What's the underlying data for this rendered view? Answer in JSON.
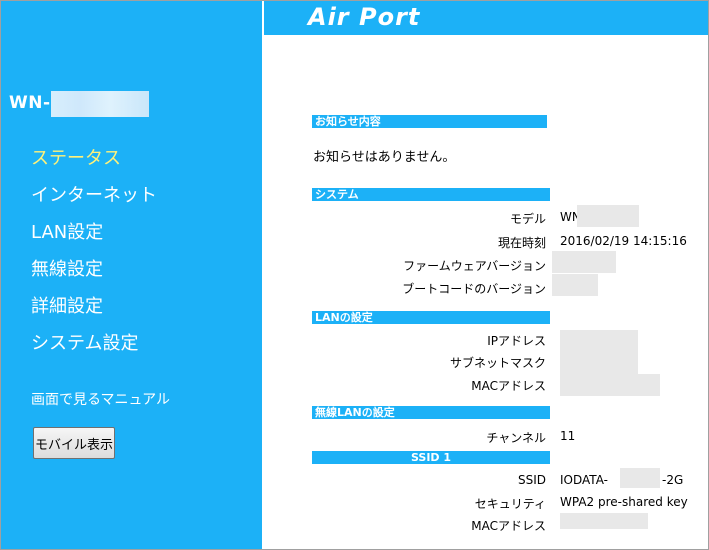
{
  "header": {
    "logo": "Air Port"
  },
  "sidebar": {
    "model_prefix": "WN-",
    "nav_items": [
      {
        "label": "ステータス",
        "active": true
      },
      {
        "label": "インターネット"
      },
      {
        "label": "LAN設定"
      },
      {
        "label": "無線設定"
      },
      {
        "label": "詳細設定"
      },
      {
        "label": "システム設定"
      }
    ],
    "manual_link": "画面で見るマニュアル",
    "mobile_button": "モバイル表示"
  },
  "notice": {
    "title": "お知らせ内容",
    "text": "お知らせはありません。"
  },
  "system": {
    "title": "システム",
    "model_label": "モデル",
    "model_value": "WN",
    "time_label": "現在時刻",
    "time_value": "2016/02/19 14:15:16",
    "firmware_label": "ファームウェアバージョン",
    "boot_label": "ブートコードのバージョン"
  },
  "lan": {
    "title": "LANの設定",
    "ip_label": "IPアドレス",
    "subnet_label": "サブネットマスク",
    "mac_label": "MACアドレス"
  },
  "wireless": {
    "title": "無線LANの設定",
    "channel_label": "チャンネル",
    "channel_value": "11",
    "ssid_header": "SSID 1",
    "ssid_label": "SSID",
    "ssid_value_prefix": "IODATA-",
    "ssid_value_suffix": "-2G",
    "security_label": "セキュリティ",
    "security_value": "WPA2 pre-shared key",
    "mac_label": "MACアドレス"
  },
  "colors": {
    "accent": "#1cb1f7",
    "active_nav": "#fff27a"
  }
}
